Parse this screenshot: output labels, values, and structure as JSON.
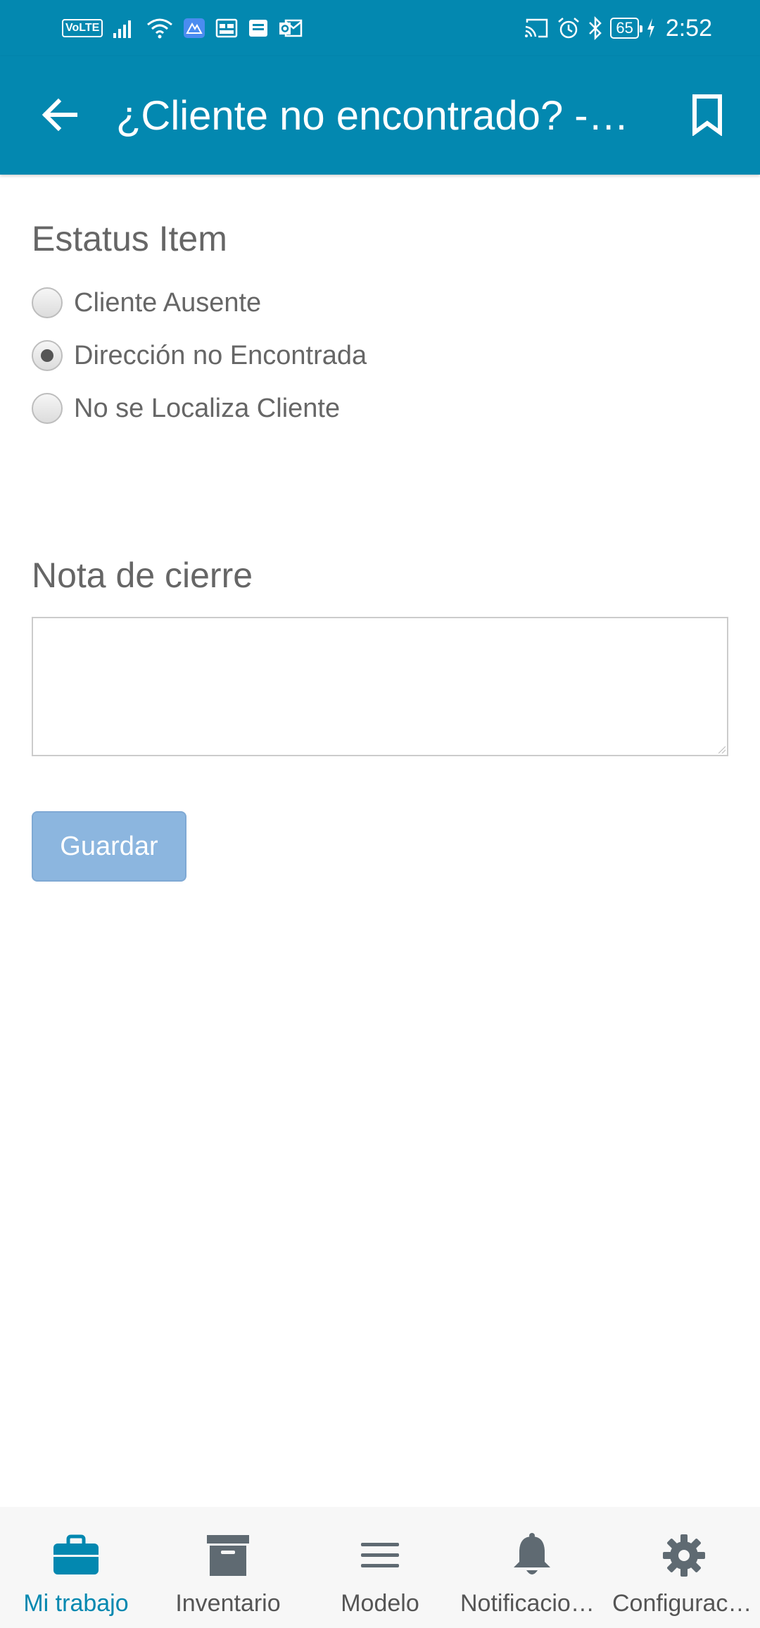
{
  "status_bar": {
    "volte": "VoLTE",
    "battery": "65",
    "time": "2:52"
  },
  "app_bar": {
    "title": "¿Cliente no encontrado? - Cliente no encontrado",
    "back_icon": "arrow-back-icon",
    "bookmark_icon": "bookmark-icon"
  },
  "form": {
    "status_title": "Estatus Item",
    "options": [
      {
        "label": "Cliente Ausente",
        "checked": false
      },
      {
        "label": "Dirección no Encontrada",
        "checked": true
      },
      {
        "label": "No se Localiza Cliente",
        "checked": false
      }
    ],
    "note_title": "Nota de cierre",
    "note_value": "",
    "save_label": "Guardar"
  },
  "bottom_nav": {
    "items": [
      {
        "label": "Mi trabajo",
        "icon": "briefcase-icon",
        "active": true
      },
      {
        "label": "Inventario",
        "icon": "archive-icon",
        "active": false
      },
      {
        "label": "Modelo",
        "icon": "menu-icon",
        "active": false
      },
      {
        "label": "Notificaciones",
        "icon": "bell-icon",
        "active": false
      },
      {
        "label": "Configuración",
        "icon": "gear-icon",
        "active": false
      }
    ]
  },
  "colors": {
    "primary": "#0388b0",
    "button": "#8cb6df",
    "text_muted": "#666666",
    "icon_gray": "#5f6a72"
  }
}
